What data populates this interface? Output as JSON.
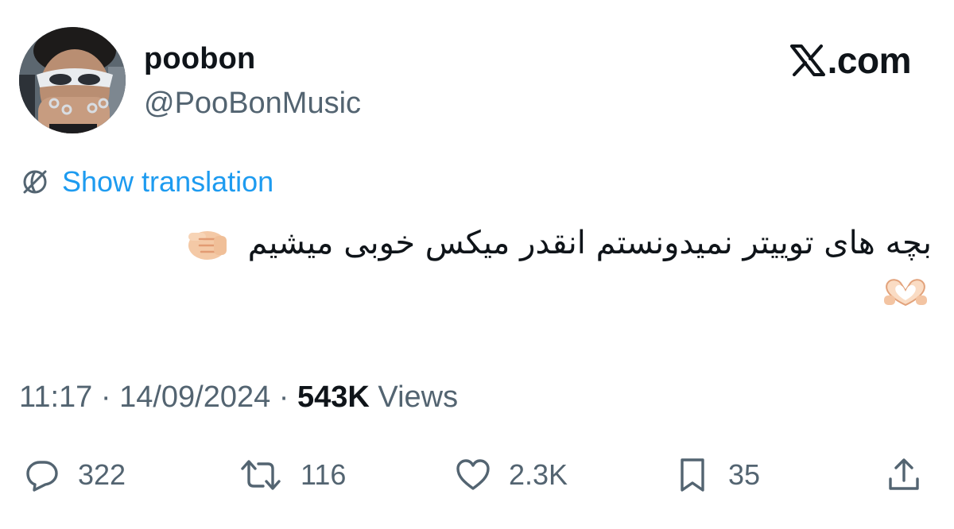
{
  "author": {
    "display_name": "poobon",
    "handle": "@PooBonMusic",
    "avatar_icon": "avatar-photo"
  },
  "brand": {
    "text": ".com",
    "logo_icon": "x-logo-icon"
  },
  "translation": {
    "label": "Show translation",
    "icon": "globe-icon"
  },
  "tweet": {
    "text": "بچه های توییتر نمیدونستم انقدر میکس خوبی میشیم",
    "emojis": [
      "pointing-fist-emoji",
      "heart-hands-emoji"
    ]
  },
  "meta": {
    "time": "11:17",
    "separator": " · ",
    "date": "14/09/2024",
    "views_count": "543K",
    "views_label": " Views"
  },
  "actions": {
    "reply": {
      "count": "322",
      "icon": "reply-icon"
    },
    "retweet": {
      "count": "116",
      "icon": "retweet-icon"
    },
    "like": {
      "count": "2.3K",
      "icon": "heart-icon"
    },
    "bookmark": {
      "count": "35",
      "icon": "bookmark-icon"
    },
    "share": {
      "icon": "share-icon"
    }
  },
  "colors": {
    "text_primary": "#0f1419",
    "text_secondary": "#536471",
    "link": "#1d9bf0",
    "background": "#ffffff"
  }
}
